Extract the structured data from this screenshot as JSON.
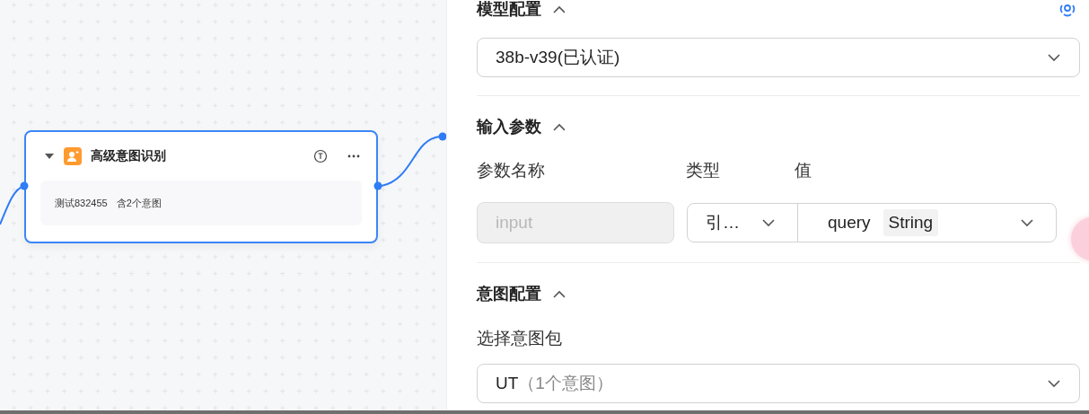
{
  "canvas": {
    "node": {
      "title": "高级意图识别",
      "expanded": true,
      "summary": [
        "测试832455",
        "含2个意图"
      ]
    }
  },
  "panel": {
    "sections": [
      {
        "kind": "model",
        "title": "模型配置",
        "expanded": true,
        "select": {
          "value": "38b-v39(已认证)"
        }
      },
      {
        "kind": "params",
        "title": "输入参数",
        "expanded": true,
        "columns": [
          "参数名称",
          "类型",
          "值"
        ],
        "rows": [
          {
            "name": "input",
            "name_disabled": true,
            "type": "引…",
            "value": "query",
            "value_type": "String"
          }
        ]
      },
      {
        "kind": "intent",
        "title": "意图配置",
        "expanded": true,
        "label": "选择意图包",
        "select": {
          "value": "UT",
          "hint": "（1个意图）"
        }
      }
    ]
  }
}
